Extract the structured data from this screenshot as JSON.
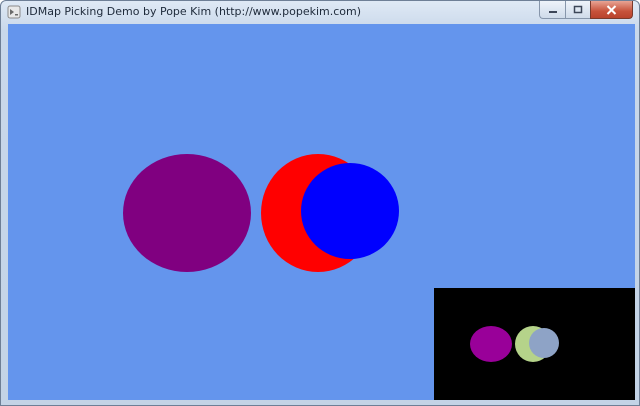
{
  "window": {
    "title": "IDMap Picking Demo by Pope Kim (http://www.popekim.com)",
    "icon": "app-icon"
  },
  "scene": {
    "background_color": "#6495ed",
    "spheres": [
      {
        "name": "purple-sphere",
        "color": "#800080"
      },
      {
        "name": "red-sphere",
        "color": "#ff0000"
      },
      {
        "name": "blue-sphere",
        "color": "#0000ff"
      }
    ]
  },
  "idmap_preview": {
    "background_color": "#000000",
    "shapes": [
      {
        "name": "id-purple-sphere",
        "color": "#990099"
      },
      {
        "name": "id-green-sphere",
        "color": "#b5d38a"
      },
      {
        "name": "id-blue-sphere",
        "color": "#8ea3c6"
      }
    ]
  }
}
